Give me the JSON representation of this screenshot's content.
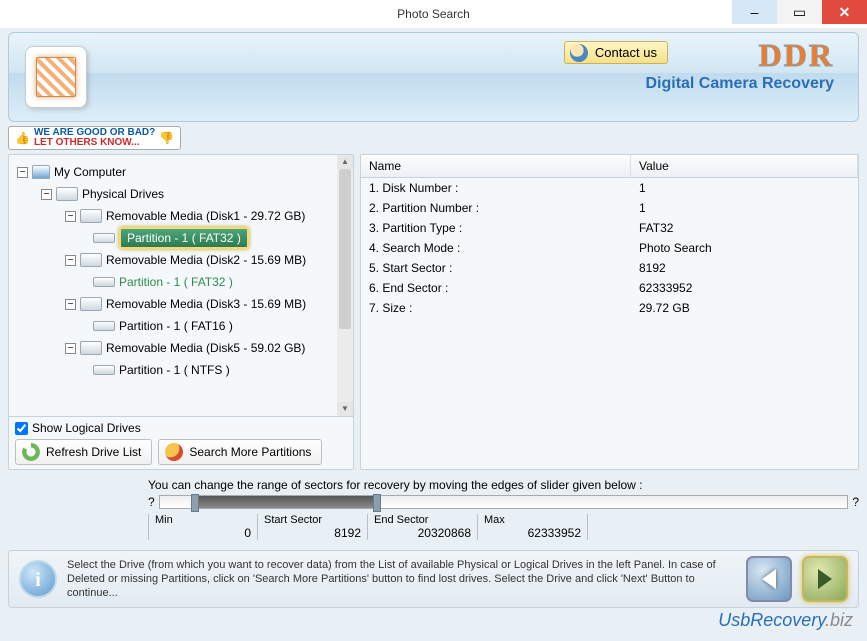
{
  "window": {
    "title": "Photo Search"
  },
  "header": {
    "contact": "Contact us",
    "brand": "DDR",
    "subtitle": "Digital Camera Recovery"
  },
  "feedback": {
    "line1": "WE ARE GOOD OR BAD?",
    "line2": "LET OTHERS KNOW..."
  },
  "tree": {
    "root": "My Computer",
    "phys": "Physical Drives",
    "d1": "Removable Media (Disk1 - 29.72 GB)",
    "d1p1": "Partition - 1 ( FAT32 )",
    "d2": "Removable Media (Disk2 - 15.69 MB)",
    "d2p1": "Partition - 1 ( FAT32 )",
    "d3": "Removable Media (Disk3 - 15.69 MB)",
    "d3p1": "Partition - 1 ( FAT16 )",
    "d4": "Removable Media (Disk5 - 59.02 GB)",
    "d4p1": "Partition - 1 ( NTFS )"
  },
  "left_bottom": {
    "show_logical": "Show Logical Drives",
    "refresh": "Refresh Drive List",
    "search_more": "Search More Partitions"
  },
  "table": {
    "head_name": "Name",
    "head_value": "Value",
    "rows": [
      {
        "n": "1. Disk Number :",
        "v": "1"
      },
      {
        "n": "2. Partition Number :",
        "v": "1"
      },
      {
        "n": "3. Partition Type :",
        "v": "FAT32"
      },
      {
        "n": "4. Search Mode :",
        "v": "Photo Search"
      },
      {
        "n": "5. Start Sector :",
        "v": "8192"
      },
      {
        "n": "6. End Sector :",
        "v": "62333952"
      },
      {
        "n": "7. Size :",
        "v": "29.72 GB"
      }
    ]
  },
  "slider": {
    "hint": "You can change the range of sectors for recovery by moving the edges of slider given below :",
    "min_label": "Min",
    "min_val": "0",
    "start_label": "Start Sector",
    "start_val": "8192",
    "end_label": "End Sector",
    "end_val": "20320868",
    "max_label": "Max",
    "max_val": "62333952"
  },
  "info": {
    "text": "Select the Drive (from which you want to recover data) from the List of available Physical or Logical Drives in the left Panel. In case of Deleted or missing Partitions, click on 'Search More Partitions' button to find lost drives. Select the Drive and click 'Next' Button to continue..."
  },
  "footer": {
    "site": "UsbRecovery",
    "tld": ".biz"
  }
}
